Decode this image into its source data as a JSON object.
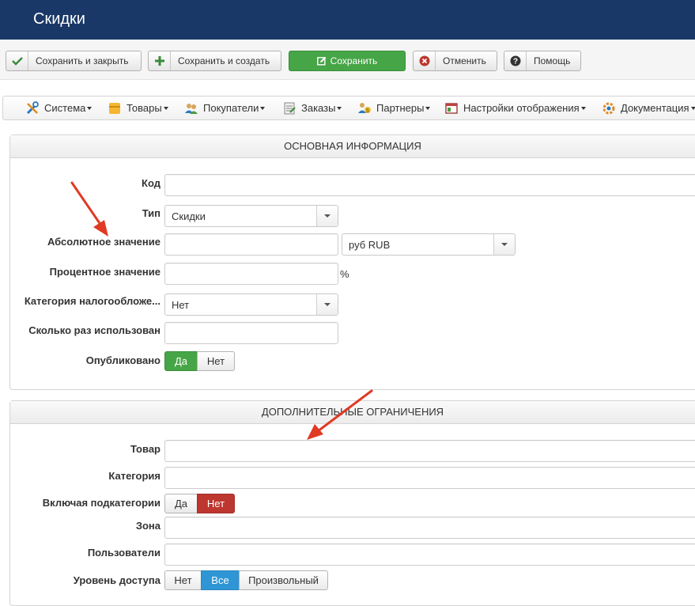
{
  "header": {
    "title": "Скидки"
  },
  "toolbar": {
    "save_close": "Сохранить и закрыть",
    "save_new": "Сохранить и создать",
    "save": "Сохранить",
    "cancel": "Отменить",
    "help": "Помощь"
  },
  "menu": {
    "items": [
      {
        "label": "Система",
        "icon": "tools-icon"
      },
      {
        "label": "Товары",
        "icon": "box-icon"
      },
      {
        "label": "Покупатели",
        "icon": "users-icon"
      },
      {
        "label": "Заказы",
        "icon": "orders-icon"
      },
      {
        "label": "Партнеры",
        "icon": "partners-icon"
      },
      {
        "label": "Настройки отображения",
        "icon": "display-icon"
      },
      {
        "label": "Документация",
        "icon": "help-gear-icon"
      }
    ]
  },
  "basic": {
    "title": "ОСНОВНАЯ ИНФОРМАЦИЯ",
    "code_label": "Код",
    "type_label": "Тип",
    "type_value": "Скидки",
    "abs_label": "Абсолютное значение",
    "currency_value": "руб RUB",
    "pct_label": "Процентное значение",
    "pct_sign": "%",
    "tax_label": "Категория налогообложе...",
    "tax_value": "Нет",
    "used_label": "Сколько раз использован",
    "published_label": "Опубликовано",
    "published_yes": "Да",
    "published_no": "Нет",
    "published_selected": "Да"
  },
  "extra": {
    "title": "ДОПОЛНИТЕЛЬНЫЕ ОГРАНИЧЕНИЯ",
    "product_label": "Товар",
    "category_label": "Категория",
    "subcat_label": "Включая подкатегории",
    "subcat_yes": "Да",
    "subcat_no": "Нет",
    "subcat_selected": "Нет",
    "zone_label": "Зона",
    "users_label": "Пользователи",
    "access_label": "Уровень доступа",
    "access_none": "Нет",
    "access_all": "Все",
    "access_custom": "Произвольный",
    "access_selected": "Все"
  },
  "colors": {
    "header_bg": "#1a3867",
    "save_green": "#46a546",
    "toggle_red": "#bd362f",
    "toggle_blue": "#2f96d6",
    "annotation_arrow": "#e03a24"
  }
}
